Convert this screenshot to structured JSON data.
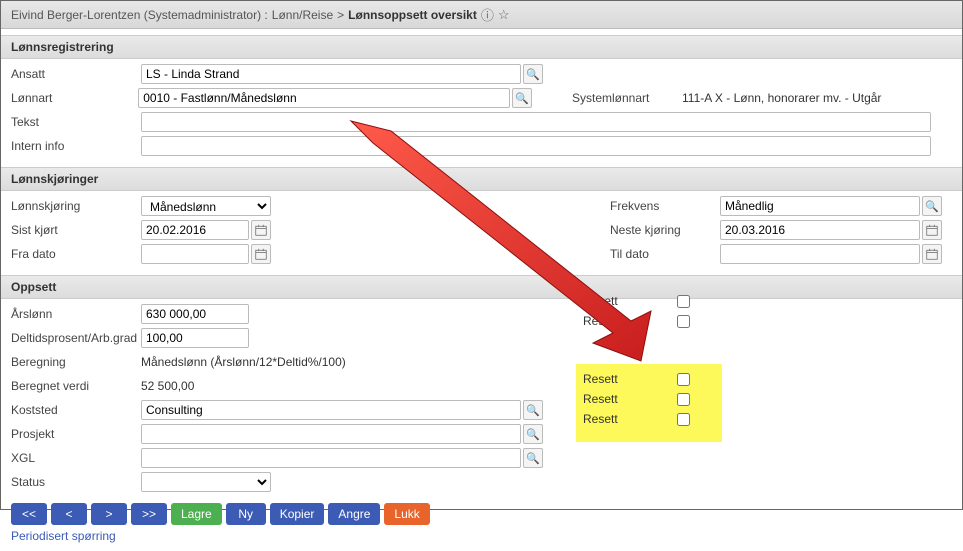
{
  "breadcrumb": {
    "user": "Eivind Berger-Lorentzen (Systemadministrator) :",
    "path1": "Lønn/Reise",
    "sep": ">",
    "current": "Lønnsoppsett oversikt"
  },
  "sections": {
    "reg": "Lønnsregistrering",
    "run": "Lønnskjøringer",
    "setup": "Oppsett"
  },
  "reg": {
    "ansatt_label": "Ansatt",
    "ansatt_value": "LS - Linda Strand",
    "lonnart_label": "Lønnart",
    "lonnart_value": "0010 - Fastlønn/Månedslønn",
    "syslonnart_label": "Systemlønnart",
    "syslonnart_value": "111-A X - Lønn, honorarer mv. - Utgår",
    "tekst_label": "Tekst",
    "tekst_value": "",
    "intern_label": "Intern info",
    "intern_value": ""
  },
  "run": {
    "kjoring_label": "Lønnskjøring",
    "kjoring_value": "Månedslønn",
    "frekvens_label": "Frekvens",
    "frekvens_value": "Månedlig",
    "sist_label": "Sist kjørt",
    "sist_value": "20.02.2016",
    "neste_label": "Neste kjøring",
    "neste_value": "20.03.2016",
    "fra_label": "Fra dato",
    "fra_value": "",
    "til_label": "Til dato",
    "til_value": ""
  },
  "setup": {
    "arslonn_label": "Årslønn",
    "arslonn_value": "630 000,00",
    "deltid_label": "Deltidsprosent/Arb.grad",
    "deltid_value": "100,00",
    "beregning_label": "Beregning",
    "beregning_value": "Månedslønn (Årslønn/12*Deltid%/100)",
    "beregnet_label": "Beregnet verdi",
    "beregnet_value": "52 500,00",
    "koststed_label": "Koststed",
    "koststed_value": "Consulting",
    "prosjekt_label": "Prosjekt",
    "prosjekt_value": "",
    "xgl_label": "XGL",
    "xgl_value": "",
    "status_label": "Status",
    "status_value": ""
  },
  "resett": {
    "label": "Resett"
  },
  "buttons": {
    "first": "<<",
    "prev": "<",
    "next": ">",
    "last": ">>",
    "lagre": "Lagre",
    "ny": "Ny",
    "kopier": "Kopier",
    "angre": "Angre",
    "lukk": "Lukk"
  },
  "footer": {
    "link": "Periodisert spørring"
  }
}
